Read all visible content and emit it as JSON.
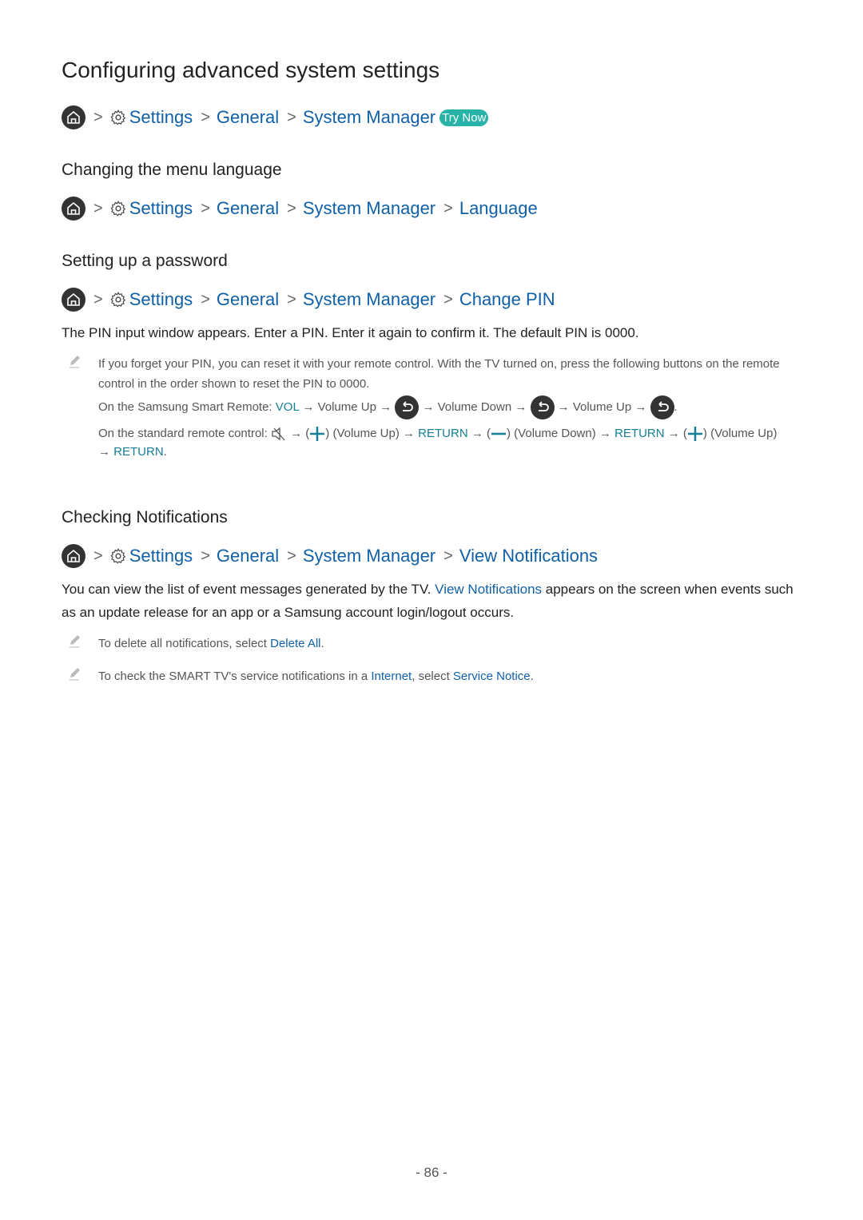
{
  "title": "Configuring advanced system settings",
  "try_now": "Try Now",
  "breadcrumbs": {
    "main": [
      "Settings",
      "General",
      "System Manager"
    ],
    "language": [
      "Settings",
      "General",
      "System Manager",
      "Language"
    ],
    "pin": [
      "Settings",
      "General",
      "System Manager",
      "Change PIN"
    ],
    "notifications": [
      "Settings",
      "General",
      "System Manager",
      "View Notifications"
    ]
  },
  "sections": {
    "language": {
      "heading": "Changing the menu language"
    },
    "password": {
      "heading": "Setting up a password",
      "body": "The PIN input window appears. Enter a PIN. Enter it again to confirm it. The default PIN is 0000.",
      "note_line1": "If you forget your PIN, you can reset it with your remote control. With the TV turned on, press the following buttons on the remote control in the order shown to reset the PIN to 0000.",
      "smart_remote": {
        "prefix": "On the Samsung Smart Remote: ",
        "vol": "VOL",
        "step1": " → Volume Up → ",
        "step2": " → Volume Down → ",
        "step3": " → Volume Up → ",
        "end": "."
      },
      "standard_remote": {
        "prefix": "On the standard remote control: ",
        "a1": " → (",
        "a2": ") (Volume Up) → ",
        "return": "RETURN",
        "a3": " → (",
        "a4": ") (Volume Down) → ",
        "a5": " → (",
        "a6": ") (Volume Up)",
        "a7": "→ ",
        "end": "."
      }
    },
    "notifications": {
      "heading": "Checking Notifications",
      "body_pre": "You can view the list of event messages generated by the TV. ",
      "body_link": "View Notifications",
      "body_post": " appears on the screen when events such as an update release for an app or a Samsung account login/logout occurs.",
      "note1_pre": "To delete all notifications, select ",
      "note1_link": "Delete All",
      "note1_post": ".",
      "note2_pre": "To check the SMART TV's service notifications in a ",
      "note2_link1": "Internet",
      "note2_mid": ", select ",
      "note2_link2": "Service Notice",
      "note2_post": "."
    }
  },
  "page_number": "- 86 -"
}
